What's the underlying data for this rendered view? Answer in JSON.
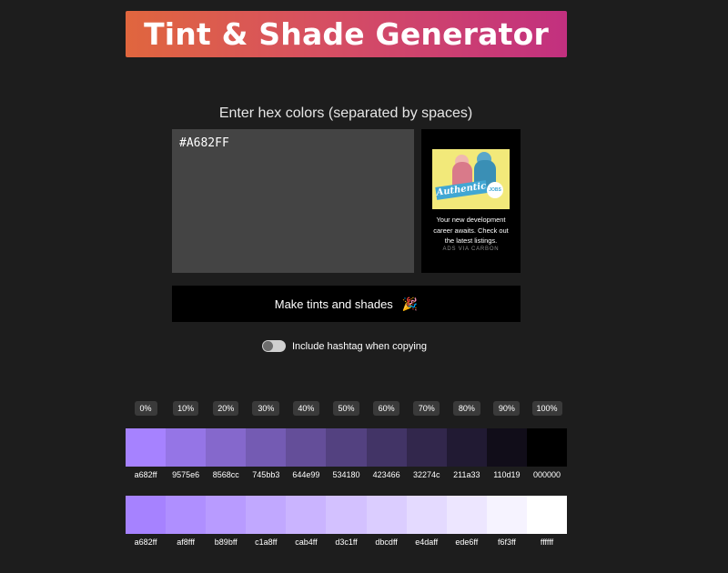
{
  "header": {
    "title": "Tint & Shade Generator"
  },
  "form": {
    "prompt": "Enter hex colors (separated by spaces)",
    "input_value": "#A682FF",
    "make_button_label": "Make tints and shades",
    "make_button_emoji": "🎉",
    "hashtag_toggle_label": "Include hashtag when copying",
    "hashtag_toggle_on": false
  },
  "ad": {
    "image_sign_text": "Authentic",
    "image_badge_text": "JOBS",
    "text": "Your new development career awaits. Check out the latest listings.",
    "via": "ADS VIA CARBON"
  },
  "percentages": [
    "0%",
    "10%",
    "20%",
    "30%",
    "40%",
    "50%",
    "60%",
    "70%",
    "80%",
    "90%",
    "100%"
  ],
  "shades": [
    "a682ff",
    "9575e6",
    "8568cc",
    "745bb3",
    "644e99",
    "534180",
    "423466",
    "32274c",
    "211a33",
    "110d19",
    "000000"
  ],
  "tints": [
    "a682ff",
    "af8fff",
    "b89bff",
    "c1a8ff",
    "cab4ff",
    "d3c1ff",
    "dbcdff",
    "e4daff",
    "ede6ff",
    "f6f3ff",
    "ffffff"
  ]
}
